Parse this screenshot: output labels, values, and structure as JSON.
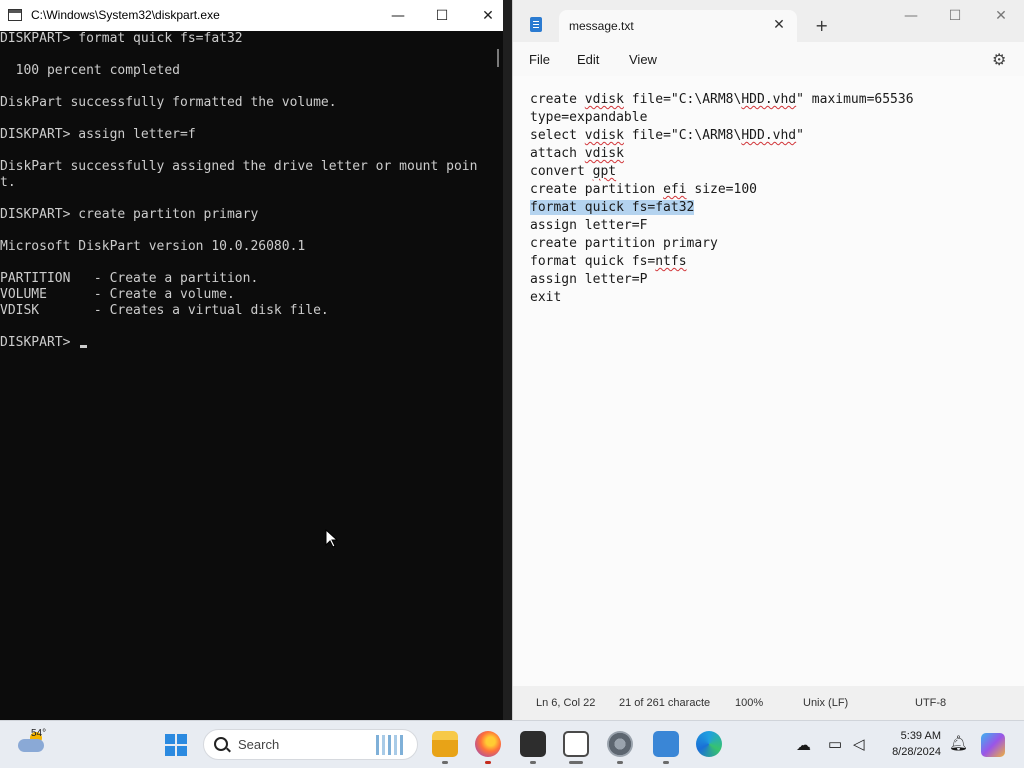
{
  "console": {
    "title": "C:\\Windows\\System32\\diskpart.exe",
    "lines": [
      "DISKPART> format quick fs=fat32",
      "",
      "  100 percent completed",
      "",
      "DiskPart successfully formatted the volume.",
      "",
      "DISKPART> assign letter=f",
      "",
      "DiskPart successfully assigned the drive letter or mount poin",
      "t.",
      "",
      "DISKPART> create partiton primary",
      "",
      "Microsoft DiskPart version 10.0.26080.1",
      "",
      "PARTITION   - Create a partition.",
      "VOLUME      - Create a volume.",
      "VDISK       - Creates a virtual disk file.",
      "",
      "DISKPART> "
    ],
    "window_buttons": {
      "minimize": "—",
      "maximize": "☐",
      "close": "✕"
    }
  },
  "notepad": {
    "tab_title": "message.txt",
    "tab_close": "✕",
    "new_tab": "+",
    "menu": [
      "File",
      "Edit",
      "View"
    ],
    "settings_icon": "gear-icon",
    "window_buttons": {
      "minimize": "—",
      "maximize": "☐",
      "close": "✕"
    },
    "lines": [
      {
        "parts": [
          {
            "t": "create "
          },
          {
            "t": "vdisk",
            "spell": true
          },
          {
            "t": " file=\"C:\\ARM8\\"
          },
          {
            "t": "HDD.vhd",
            "spell": true
          },
          {
            "t": "\" maximum=65536"
          }
        ]
      },
      {
        "parts": [
          {
            "t": "type=expandable"
          }
        ]
      },
      {
        "parts": [
          {
            "t": "select "
          },
          {
            "t": "vdisk",
            "spell": true
          },
          {
            "t": " file=\"C:\\ARM8\\"
          },
          {
            "t": "HDD.vhd",
            "spell": true
          },
          {
            "t": "\""
          }
        ]
      },
      {
        "parts": [
          {
            "t": "attach "
          },
          {
            "t": "vdisk",
            "spell": true
          }
        ]
      },
      {
        "parts": [
          {
            "t": "convert "
          },
          {
            "t": "gpt",
            "spell": true
          }
        ]
      },
      {
        "parts": [
          {
            "t": "create partition "
          },
          {
            "t": "efi",
            "spell": true
          },
          {
            "t": " size=100"
          }
        ]
      },
      {
        "parts": [
          {
            "t": "format quick fs=fat32",
            "selected": true
          }
        ]
      },
      {
        "parts": [
          {
            "t": "assign letter=F"
          }
        ]
      },
      {
        "parts": [
          {
            "t": "create partition primary"
          }
        ]
      },
      {
        "parts": [
          {
            "t": "format quick fs="
          },
          {
            "t": "ntfs",
            "spell": true
          }
        ]
      },
      {
        "parts": [
          {
            "t": "assign letter=P"
          }
        ]
      },
      {
        "parts": [
          {
            "t": "exit"
          }
        ]
      }
    ],
    "status": {
      "position": "Ln 6, Col 22",
      "selection": "21 of 261 characte",
      "zoom": "100%",
      "line_ending": "Unix (LF)",
      "encoding": "UTF-8"
    }
  },
  "taskbar": {
    "temperature": "54°",
    "search_placeholder": "Search",
    "time": "5:39 AM",
    "date": "8/28/2024",
    "apps": [
      "file-explorer-icon",
      "firefox-icon",
      "terminal-icon",
      "diskpart-icon",
      "settings-icon",
      "notepad-icon",
      "edge-icon"
    ],
    "accent_color": "#2b8ae0"
  }
}
